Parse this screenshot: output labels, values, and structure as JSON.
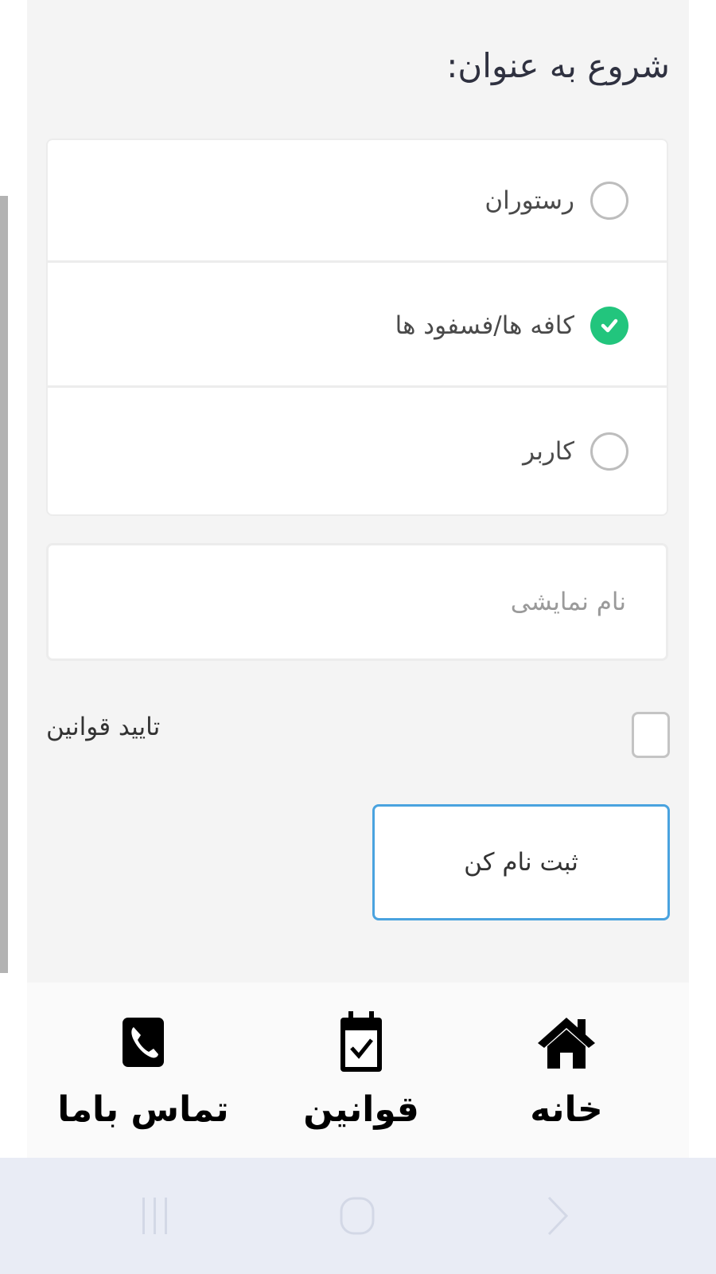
{
  "form": {
    "heading": "شروع به عنوان:",
    "options": [
      {
        "label": "رستوران",
        "selected": false
      },
      {
        "label": "کافه ها/فسفود ها",
        "selected": true
      },
      {
        "label": "کاربر",
        "selected": false
      }
    ],
    "display_name": {
      "value": "",
      "placeholder": "نام نمایشی"
    },
    "terms": {
      "label": "تایید قوانین",
      "checked": false
    },
    "submit_label": "ثبت نام کن"
  },
  "bottom_nav": {
    "items": [
      {
        "label": "خانه",
        "icon": "home-icon"
      },
      {
        "label": "قوانین",
        "icon": "calendar-check-icon"
      },
      {
        "label": "تماس باما",
        "icon": "phone-icon"
      }
    ]
  },
  "system_nav": {
    "icons": [
      "recent-apps-icon",
      "home-circle-icon",
      "back-chevron-icon"
    ]
  },
  "colors": {
    "accent_green": "#22c57d",
    "button_border": "#4aa3df",
    "panel_bg": "#f4f4f4",
    "system_bar_bg": "#e9ecf5"
  }
}
